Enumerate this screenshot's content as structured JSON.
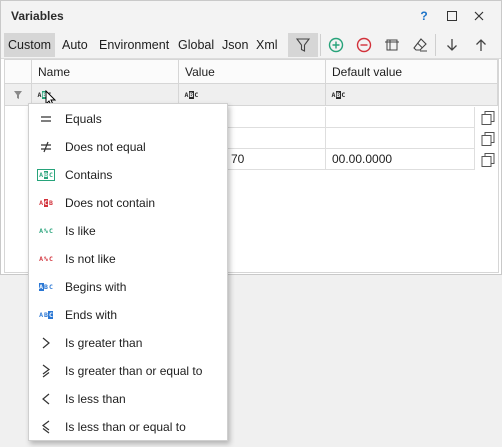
{
  "window": {
    "title": "Variables",
    "help": "?"
  },
  "tabs": [
    "Custom",
    "Auto",
    "Environment",
    "Global",
    "Json",
    "Xml"
  ],
  "columns": {
    "name": "Name",
    "value": "Value",
    "default": "Default value"
  },
  "rows": [
    {
      "value": "",
      "default": ""
    },
    {
      "value": "",
      "default": ""
    },
    {
      "value": "70",
      "default": "00.00.0000"
    }
  ],
  "abc_text": {
    "a": "A",
    "b": "B",
    "c": "C"
  },
  "menu": [
    {
      "label": "Equals",
      "icon": "equals-icon"
    },
    {
      "label": "Does not equal",
      "icon": "not-equal-icon"
    },
    {
      "label": "Contains",
      "icon": "contains-icon"
    },
    {
      "label": "Does not contain",
      "icon": "does-not-contain-icon"
    },
    {
      "label": "Is like",
      "icon": "is-like-icon"
    },
    {
      "label": "Is not like",
      "icon": "is-not-like-icon"
    },
    {
      "label": "Begins with",
      "icon": "begins-with-icon"
    },
    {
      "label": "Ends with",
      "icon": "ends-with-icon"
    },
    {
      "label": "Is greater than",
      "icon": "greater-than-icon"
    },
    {
      "label": "Is greater than or equal to",
      "icon": "greater-or-equal-icon"
    },
    {
      "label": "Is less than",
      "icon": "less-than-icon"
    },
    {
      "label": "Is less than or equal to",
      "icon": "less-or-equal-icon"
    }
  ],
  "colors": {
    "accent_green": "#27a37a",
    "accent_red": "#d2313a",
    "accent_blue": "#2a77d4",
    "pressed": "#d6d6d6"
  }
}
